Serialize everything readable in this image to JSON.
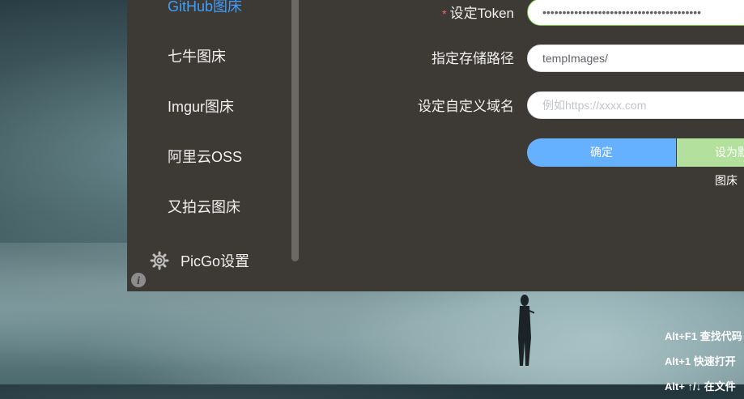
{
  "sidebar": {
    "items": [
      {
        "label": "GitHub图床",
        "active": true
      },
      {
        "label": "七牛图床"
      },
      {
        "label": "Imgur图床"
      },
      {
        "label": "阿里云OSS"
      },
      {
        "label": "又拍云图床"
      }
    ],
    "settings": {
      "label": "PicGo设置",
      "icon": "gear-icon"
    },
    "info_icon": "info-icon"
  },
  "form": {
    "token": {
      "required_mark": "*",
      "label": "设定Token",
      "value": "••••••••••••••••••••••••••••••••••••••••"
    },
    "path": {
      "label": "指定存储路径",
      "value": "tempImages/"
    },
    "domain": {
      "label": "设定自定义域名",
      "placeholder": "例如https://xxxx.com"
    },
    "confirm_label": "确定",
    "default_label": "设为默认图床"
  },
  "desktop": {
    "shortcuts": [
      "Alt+F1 查找代码",
      "Alt+1 快速打开",
      "Alt+ ↑/↓ 在文件"
    ]
  },
  "colors": {
    "accent": "#409eff",
    "confirm": "#66b1ff",
    "default": "#b3e19d",
    "panel": "#3d3935",
    "required": "#f56c6c"
  }
}
